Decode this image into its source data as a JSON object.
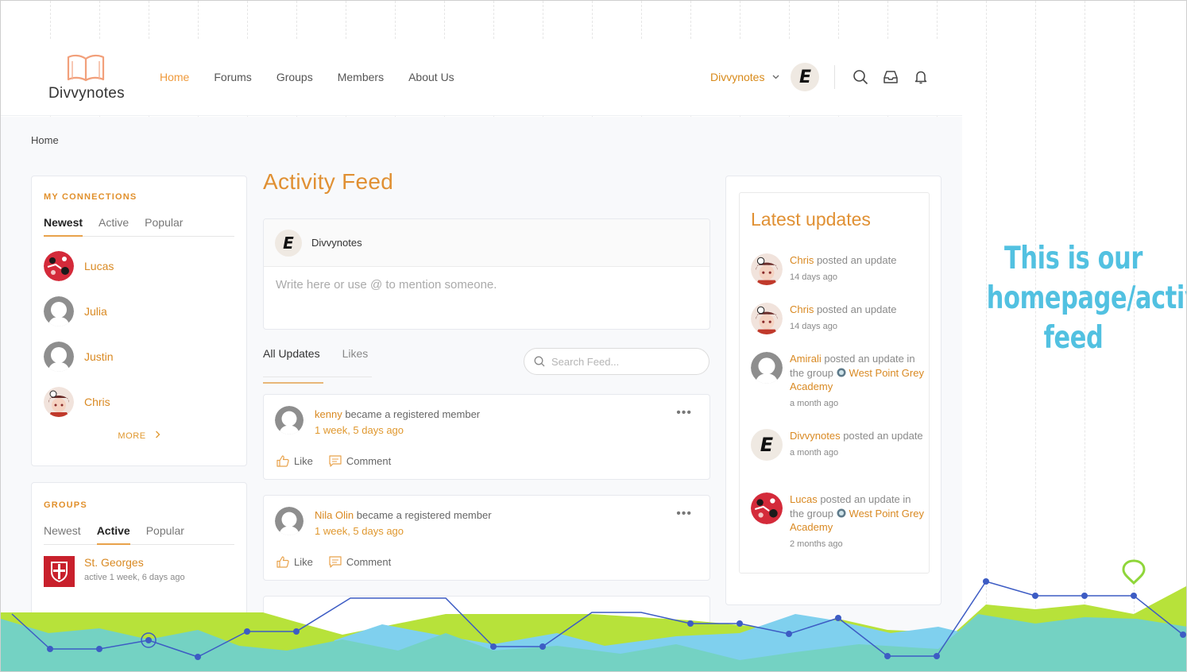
{
  "brand": {
    "name": "Divvynotes"
  },
  "nav": {
    "items": [
      {
        "label": "Home",
        "active": true
      },
      {
        "label": "Forums"
      },
      {
        "label": "Groups"
      },
      {
        "label": "Members"
      },
      {
        "label": "About Us"
      }
    ]
  },
  "user": {
    "name": "Divvynotes",
    "avatar_letter": "E"
  },
  "breadcrumb": "Home",
  "connections": {
    "title": "MY CONNECTIONS",
    "tabs": [
      "Newest",
      "Active",
      "Popular"
    ],
    "active_tab": "Newest",
    "members": [
      {
        "name": "Lucas",
        "avatar": "red-pattern"
      },
      {
        "name": "Julia",
        "avatar": "placeholder"
      },
      {
        "name": "Justin",
        "avatar": "placeholder"
      },
      {
        "name": "Chris",
        "avatar": "anime"
      }
    ],
    "more_label": "MORE"
  },
  "groups": {
    "title": "GROUPS",
    "tabs": [
      "Newest",
      "Active",
      "Popular"
    ],
    "active_tab": "Active",
    "items": [
      {
        "name": "St. Georges",
        "meta": "active 1 week, 6 days ago"
      }
    ]
  },
  "feed": {
    "title": "Activity Feed",
    "composer": {
      "user": "Divvynotes",
      "placeholder": "Write here or use @ to mention someone."
    },
    "tabs": [
      "All Updates",
      "Likes"
    ],
    "active_tab": "All Updates",
    "search_placeholder": "Search Feed...",
    "posts": [
      {
        "who": "kenny",
        "action": "became a registered member",
        "time": "1 week, 5 days ago",
        "like": "Like",
        "comment": "Comment"
      },
      {
        "who": "Nila Olin",
        "action": "became a registered member",
        "time": "1 week, 5 days ago",
        "like": "Like",
        "comment": "Comment"
      }
    ]
  },
  "updates": {
    "title": "Latest updates",
    "items": [
      {
        "who": "Chris",
        "text": " posted an update",
        "group": "",
        "time": "14 days ago",
        "avatar": "anime"
      },
      {
        "who": "Chris",
        "text": " posted an update",
        "group": "",
        "time": "14 days ago",
        "avatar": "anime"
      },
      {
        "who": "Amirali",
        "text": " posted an update in the group ",
        "group": "West Point Grey Academy",
        "time": "a month ago",
        "avatar": "placeholder"
      },
      {
        "who": "Divvynotes",
        "text": " posted an update",
        "group": "",
        "time": "a month ago",
        "avatar": "E"
      },
      {
        "who": "Lucas",
        "text": " posted an update in the group ",
        "group": "West Point Grey Academy",
        "time": "2 months ago",
        "avatar": "red-pattern"
      }
    ]
  },
  "caption": "This is our homepage/activity feed",
  "colors": {
    "accent": "#e09033",
    "caption": "#52c1e1",
    "green": "#b7e23a",
    "teal": "#74d2c3",
    "sky": "#7fd0ee",
    "line": "#3d5cc4"
  }
}
